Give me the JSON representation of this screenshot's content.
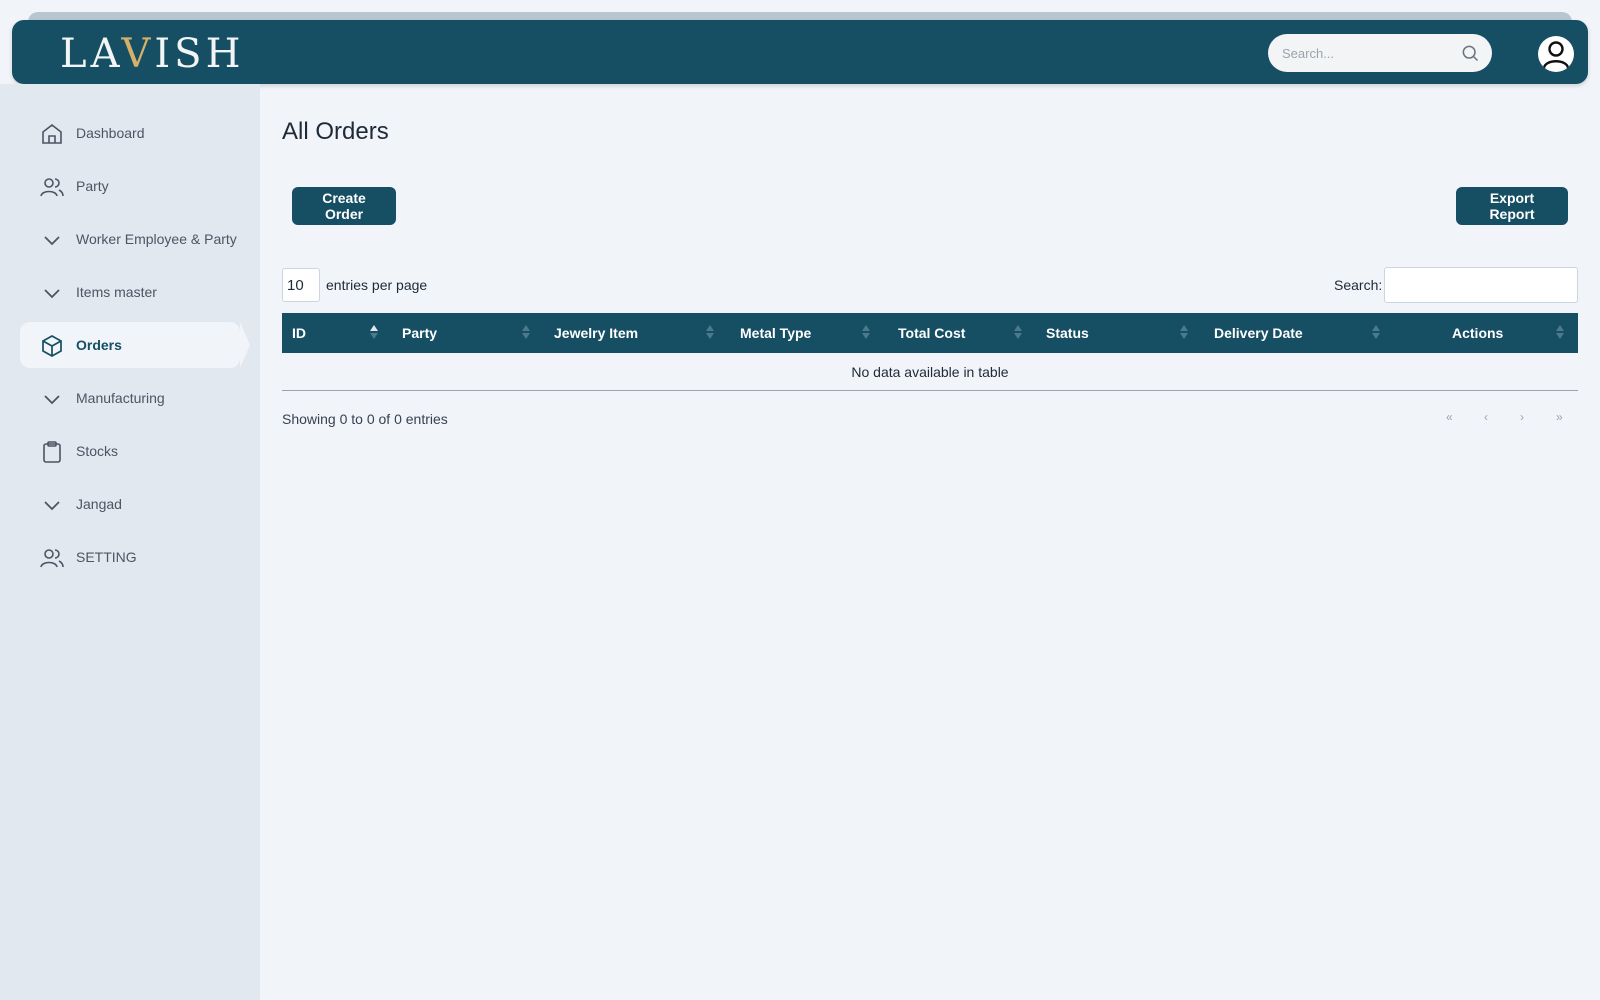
{
  "header": {
    "logo_text_a": "LA",
    "logo_text_v": "V",
    "logo_text_b": "ISH",
    "search_placeholder": "Search...",
    "brand_color": "#164e63"
  },
  "sidebar": {
    "items": [
      {
        "label": "Dashboard",
        "icon": "home-icon"
      },
      {
        "label": "Party",
        "icon": "users-icon"
      },
      {
        "label": "Worker Employee & Party",
        "icon": "chevron-down-icon"
      },
      {
        "label": "Items master",
        "icon": "chevron-down-icon"
      },
      {
        "label": "Orders",
        "icon": "box-icon",
        "active": true
      },
      {
        "label": "Manufacturing",
        "icon": "chevron-down-icon"
      },
      {
        "label": "Stocks",
        "icon": "clipboard-icon"
      },
      {
        "label": "Jangad",
        "icon": "chevron-down-icon"
      },
      {
        "label": "SETTING",
        "icon": "users-icon"
      }
    ]
  },
  "main": {
    "title": "All Orders",
    "create_label": "Create Order",
    "export_label": "Export Report",
    "entries_value": "10",
    "entries_label": "entries per page",
    "search_label": "Search:",
    "columns": [
      "ID",
      "Party",
      "Jewelry Item",
      "Metal Type",
      "Total Cost",
      "Status",
      "Delivery Date",
      "Actions"
    ],
    "empty_text": "No data available in table",
    "showing": "Showing 0 to 0 of 0 entries",
    "pager": {
      "first": "«",
      "prev": "‹",
      "next": "›",
      "last": "»"
    }
  }
}
